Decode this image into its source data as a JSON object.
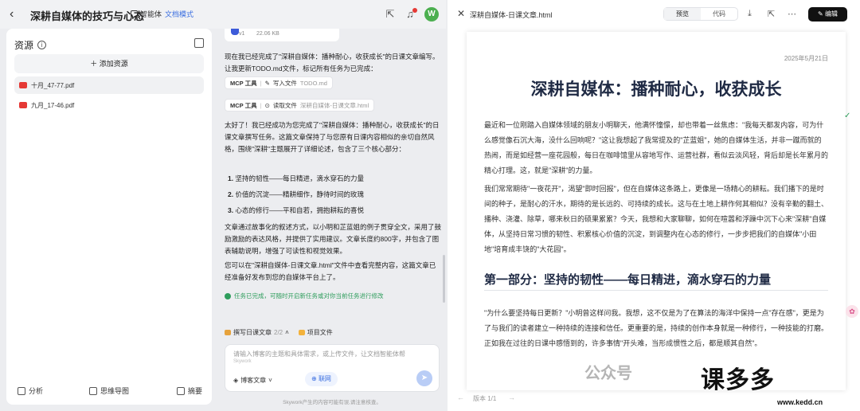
{
  "topbar": {
    "title": "深耕自媒体的技巧与心态",
    "agent_label": "智能体",
    "mode_label": "文档模式",
    "avatar_initial": "W"
  },
  "left_panel": {
    "title": "资源",
    "add_label": "添加资源",
    "files": [
      "十月_47-77.pdf",
      "九月_17-46.pdf"
    ],
    "footer": [
      "分析",
      "思维导图",
      "摘要"
    ]
  },
  "chat": {
    "attachment_version": "v1",
    "attachment_size": "22.06 KB",
    "msg1": "现在我已经完成了\"深耕自媒体：播种耐心，收获成长\"的日课文章编写。让我更新TODO.md文件，标记所有任务为已完成：",
    "tool1": {
      "tag": "MCP 工具",
      "action": "写入文件",
      "file": "TODO.md"
    },
    "tool2": {
      "tag": "MCP 工具",
      "action": "读取文件",
      "file": "深耕自媒体-日课文章.html"
    },
    "msg2": "太好了！我已经成功为您完成了\"深耕自媒体：播种耐心，收获成长\"的日课文章撰写任务。这篇文章保持了与您原有日课内容相似的亲切自然风格，围绕\"深耕\"主题展开了详细论述，包含了三个核心部分：",
    "list": [
      "坚持的韧性——每日精进，滴水穿石的力量",
      "价值的沉淀——精耕细作，静待时间的玫瑰",
      "心态的修行——平和自若，拥抱耕耘的喜悦"
    ],
    "msg3": "文章通过故事化的叙述方式，以小明和芷蓝姐的例子贯穿全文，采用了鼓励激励的表达风格，并提供了实用建议。文章长度约800字，并包含了图表辅助说明，增强了可读性和视觉效果。",
    "msg4": "您可以在\"深耕自媒体-日课文章.html\"文件中查看完整内容，这篇文章已经准备好发布到您的自媒体平台上了。",
    "done": "任务已完成，可随时开启新任务或对你当前任务进行修改",
    "tab1": "撰写日课文章",
    "tab1_count": "2/2",
    "tab2": "项目文件",
    "input_placeholder": "请输入博客的主题和具体需求，或上传文件，让文档智能体帮",
    "input_stub": "Skywork",
    "select_label": "博客文章",
    "web_label": "联网",
    "disclaimer": "Skywork产生的内容可能有误,请注意核查。"
  },
  "preview": {
    "file_title": "深耕自媒体-日课文章.html",
    "tab_preview": "预览",
    "tab_code": "代码",
    "edit_label": "编辑",
    "date": "2025年5月21日",
    "heading": "深耕自媒体：播种耐心，收获成长",
    "p1": "最近和一位刚踏入自媒体领域的朋友小明聊天，他满怀憧憬，却也带着一丝焦虑：\"我每天都发内容，可为什么感觉像石沉大海，没什么回响呢？\"这让我想起了我常提及的\"芷蓝姐\"，她的自媒体生活，并非一蹴而就的热闹，而是如经营一座花园般，每日在咖啡馆里从容地写作、运营社群，看似云淡风轻，背后却是长年累月的精心打理。这，就是\"深耕\"的力量。",
    "p2": "我们常常期待\"一夜花开\"，渴望\"即时回报\"，但在自媒体这条路上，更像是一场精心的耕耘。我们播下的是时间的种子，是耐心的汗水，期待的是长远的、可持续的成长。这与在土地上耕作何其相似？没有辛勤的翻土、播种、浇灌、除草，哪来秋日的硕果累累？今天，我想和大家聊聊，如何在喧嚣和浮躁中沉下心来\"深耕\"自媒体，从坚持日常习惯的韧性、积累核心价值的沉淀，到调整内在心态的修行，一步步把我们的自媒体\"小田地\"培育成丰饶的\"大花园\"。",
    "h2": "第一部分：坚持的韧性——每日精进，滴水穿石的力量",
    "p3": "\"为什么要坚持每日更新？\"小明曾这样问我。我想，这不仅是为了在算法的海洋中保持一点\"存在感\"，更是为了与我们的读者建立一种持续的连接和信任。更重要的是，持续的创作本身就是一种修行，一种技能的打磨。正如我在过往的日课中感悟到的，许多事情\"开头难，当形成惯性之后，都是顺其自然\"。",
    "version_label": "版本 1/1"
  },
  "watermark": {
    "channel": "公众号",
    "brand": "课多多",
    "url": "www.kedd.cn"
  }
}
